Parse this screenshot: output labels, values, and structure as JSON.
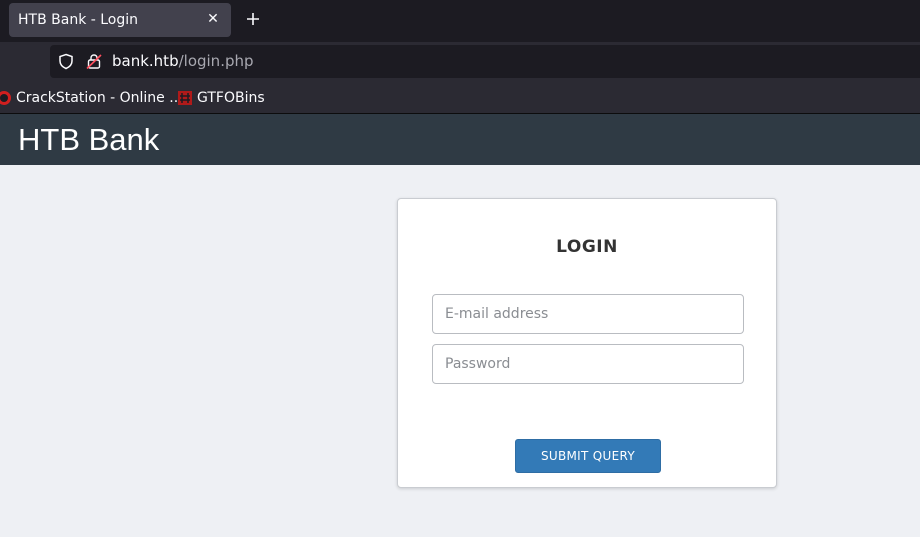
{
  "browser": {
    "tab": {
      "title": "HTB Bank - Login",
      "close_icon": "close-icon"
    },
    "new_tab_icon": "plus-icon",
    "url": {
      "host": "bank.htb",
      "path": "/login.php"
    },
    "bookmarks": [
      {
        "label": "CrackStation - Online ...",
        "icon": "crackstation-icon"
      },
      {
        "label": "GTFOBins",
        "icon": "gtfobins-icon"
      }
    ]
  },
  "site": {
    "title": "HTB Bank"
  },
  "login": {
    "heading": "LOGIN",
    "email_placeholder": "E-mail address",
    "email_value": "",
    "password_placeholder": "Password",
    "password_value": "",
    "submit_label": "SUBMIT QUERY"
  },
  "colors": {
    "header_bg": "#2f3a44",
    "page_bg": "#eef0f4",
    "button_bg": "#337ab7"
  }
}
